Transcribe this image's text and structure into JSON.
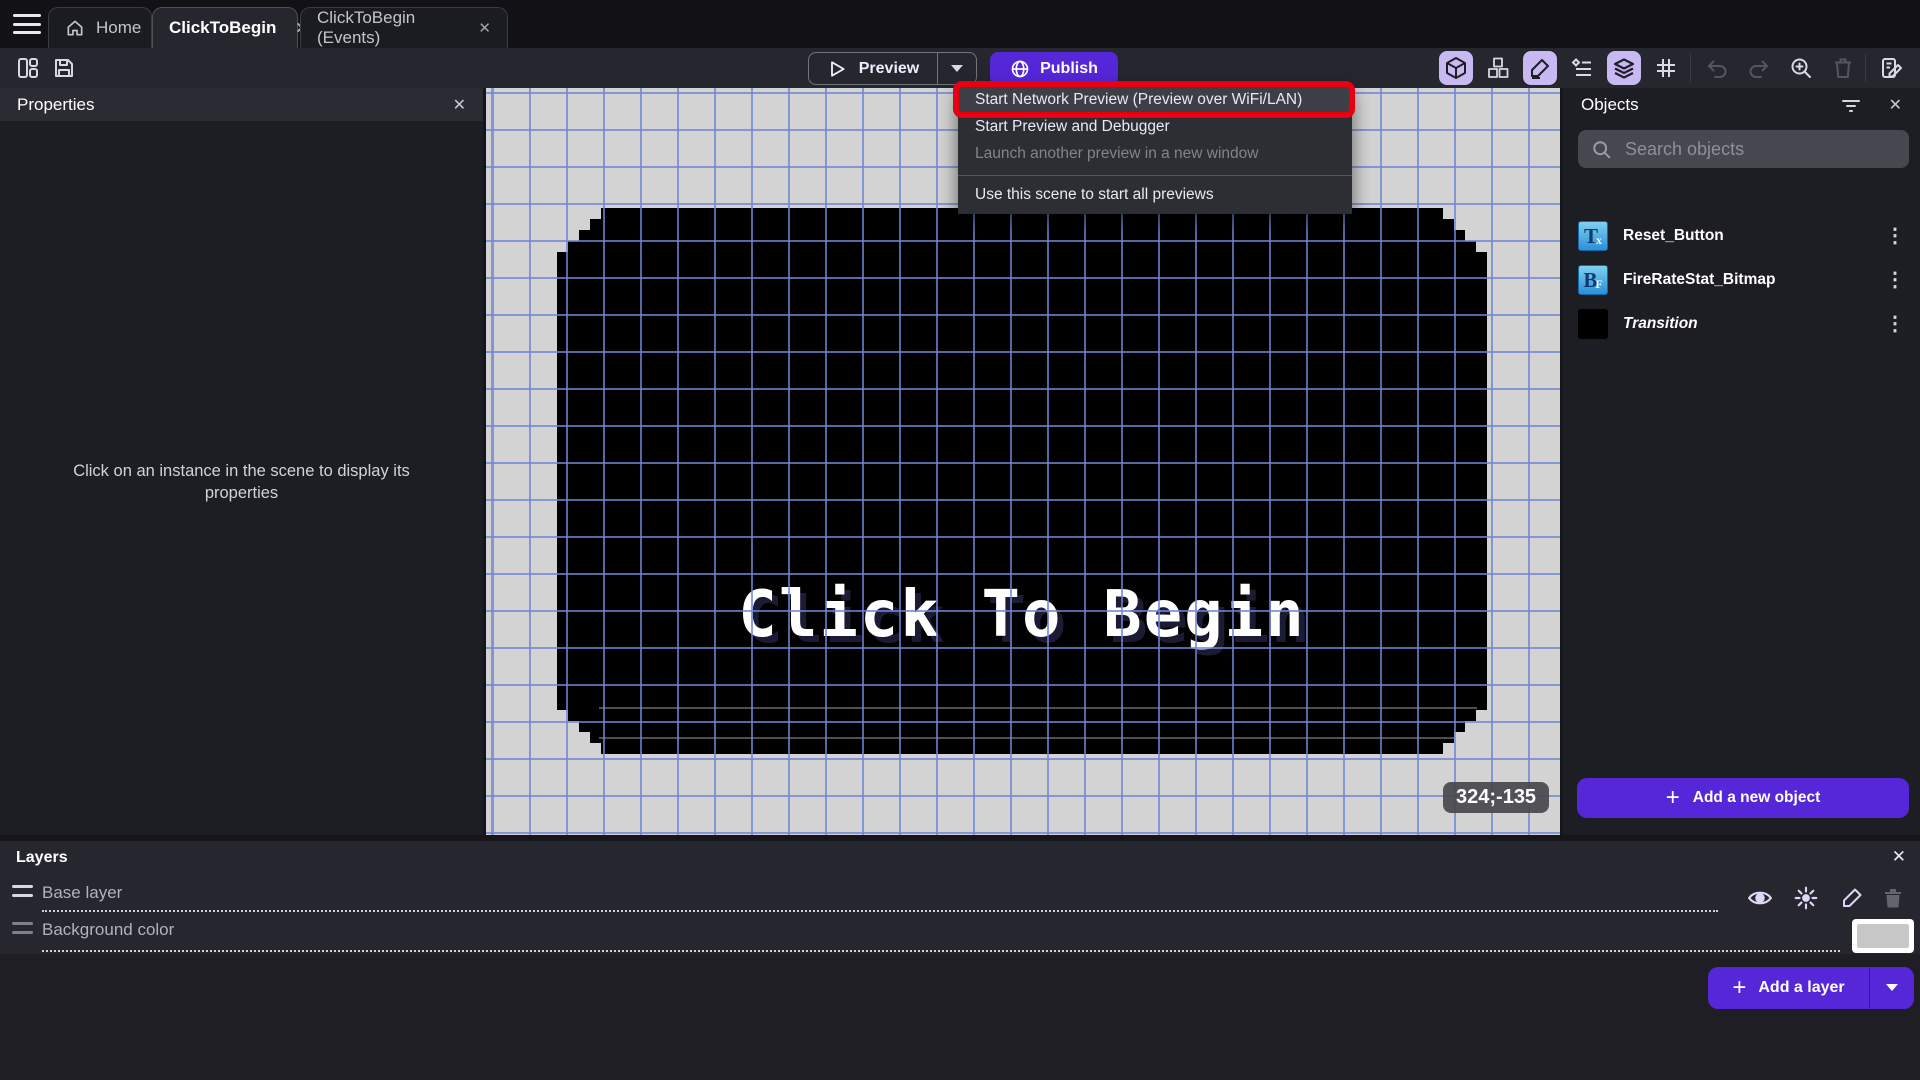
{
  "tabs": {
    "home": "Home",
    "scene_tab": "ClickToBegin",
    "events_tab": "ClickToBegin (Events)"
  },
  "toolbar": {
    "preview_label": "Preview",
    "publish_label": "Publish"
  },
  "preview_menu": {
    "item_network": "Start Network Preview (Preview over WiFi/LAN)",
    "item_debugger": "Start Preview and Debugger",
    "item_new_window": "Launch another preview in a new window",
    "item_use_scene": "Use this scene to start all previews"
  },
  "properties_panel": {
    "title": "Properties",
    "empty_hint": "Click on an instance in the scene to display its properties"
  },
  "canvas": {
    "scene_text": "Click To Begin",
    "cursor_coordinates": "324;-135"
  },
  "objects_panel": {
    "title": "Objects",
    "search_placeholder": "Search objects",
    "items": [
      {
        "label": "Reset_Button",
        "icon_main": "T",
        "icon_sub": "x"
      },
      {
        "label": "FireRateStat_Bitmap",
        "icon_main": "B",
        "icon_sub": "F"
      },
      {
        "label": "Transition"
      }
    ],
    "add_object_label": "Add a new object"
  },
  "layers_panel": {
    "title": "Layers",
    "layers": [
      {
        "name": "Base layer"
      },
      {
        "name": "Background color"
      }
    ],
    "add_layer_label": "Add a layer"
  },
  "glyphs": {
    "close": "✕",
    "kebab": "⋮",
    "plus": "+"
  },
  "colors": {
    "accent_purple": "#5627d8",
    "annotation_red": "#e60012",
    "grid_blue": "#7085d6",
    "canvas_gray": "#d3d3d3"
  }
}
